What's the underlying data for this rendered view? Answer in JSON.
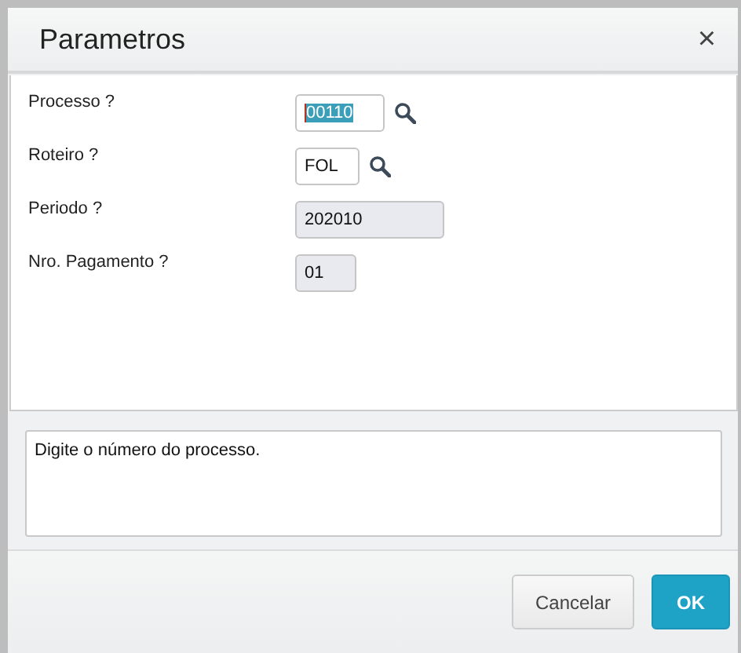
{
  "window": {
    "title": "Parametros",
    "close": "×"
  },
  "fields": [
    {
      "kind": "lookup",
      "label": "Processo ?",
      "value": "00110",
      "disabled": false,
      "focused": true
    },
    {
      "kind": "lookup",
      "label": "Roteiro ?",
      "value": "FOL",
      "disabled": false,
      "focused": false
    },
    {
      "kind": "text",
      "label": "Periodo ?",
      "value": "202010",
      "disabled": true,
      "focused": false
    },
    {
      "kind": "text",
      "label": "Nro. Pagamento ?",
      "value": "01",
      "disabled": true,
      "focused": false
    }
  ],
  "help": "Digite o número do processo.",
  "buttons": [
    {
      "label": "Cancelar",
      "kind": "secondary"
    },
    {
      "label": "OK",
      "kind": "primary"
    }
  ]
}
